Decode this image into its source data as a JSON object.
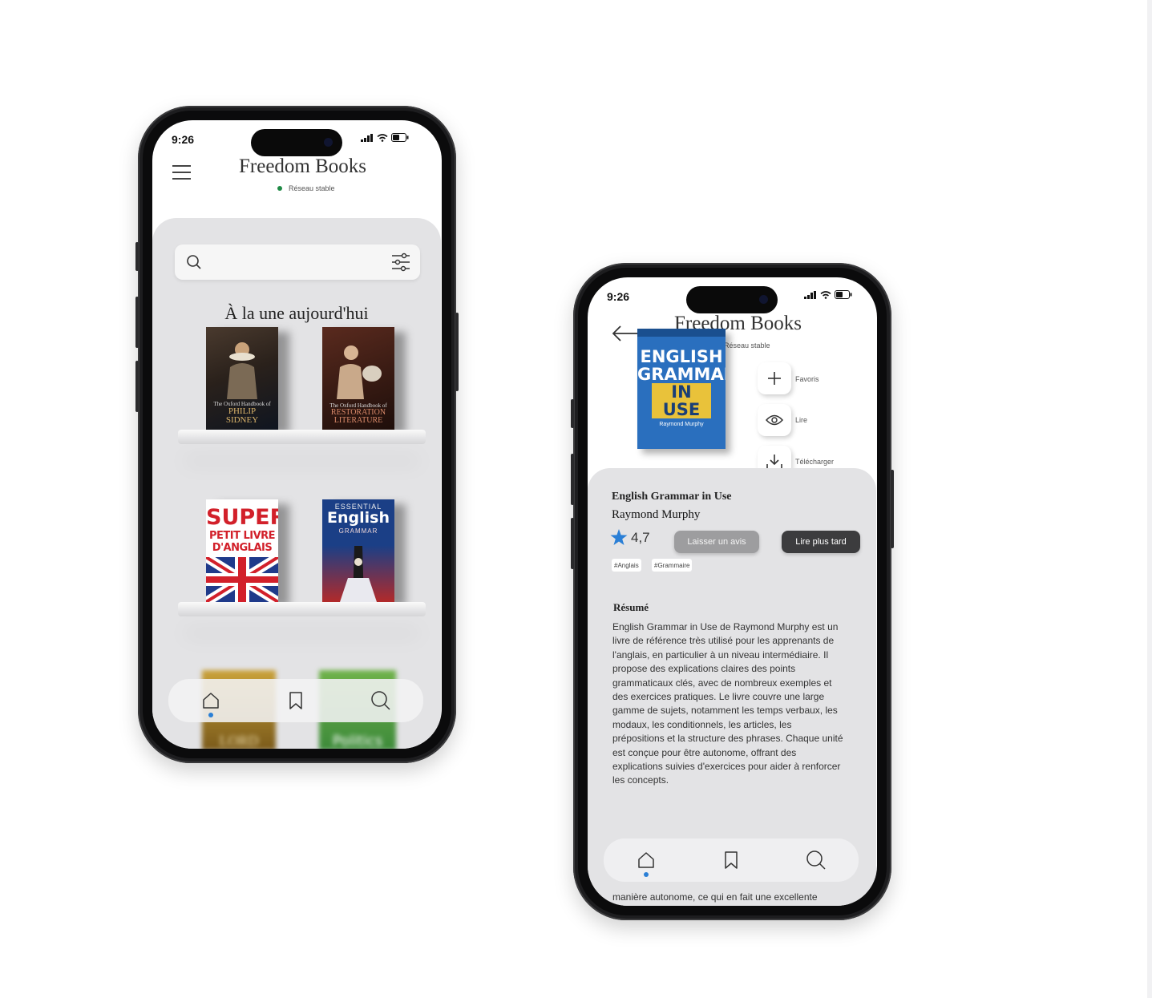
{
  "status": {
    "time": "9:26"
  },
  "app": {
    "title": "Freedom Books",
    "network": "Réseau stable"
  },
  "home": {
    "featured_title": "À la une aujourd'hui",
    "books": [
      {
        "line1": "The Oxford Handbook of",
        "line2": "PHILIP",
        "line3": "SIDNEY"
      },
      {
        "line1": "The Oxford Handbook of",
        "line2": "RESTORATION",
        "line3": "LITERATURE"
      },
      {
        "line1": "SUPER",
        "line2": "PETIT LIVRE",
        "line3": "D'ANGLAIS"
      },
      {
        "line1": "ESSENTIAL",
        "line2": "English",
        "line3": "GRAMMAR"
      }
    ],
    "partial_books": {
      "left": "LORD",
      "right": "Politics"
    }
  },
  "details": {
    "cover": {
      "line1": "ENGLISH",
      "line2": "GRAMMAR",
      "line3": "IN USE",
      "author": "Raymond Murphy"
    },
    "actions": {
      "favorites": "Favoris",
      "read": "Lire",
      "download": "Télécharger"
    },
    "title": "English Grammar in Use",
    "author": "Raymond Murphy",
    "rating": "4,7",
    "review_button": "Laisser un avis",
    "read_later_button": "Lire plus tard",
    "tags": [
      "#Anglais",
      "#Grammaire"
    ],
    "summary_title": "Résumé",
    "summary": "English Grammar in Use de Raymond Murphy est un livre de référence très utilisé pour les apprenants de l'anglais, en particulier à un niveau intermédiaire. Il propose des explications claires des points grammaticaux clés, avec de nombreux exemples et des exercices pratiques. Le livre couvre une large gamme de sujets, notamment les temps verbaux, les modaux, les conditionnels, les articles, les prépositions et la structure des phrases. Chaque unité est conçue pour être autonome, offrant des explications suivies d'exercices pour aider à renforcer les concepts.",
    "summary_tail": "manière autonome, ce qui en fait une excellente ressource pour l'auto-apprentissage ou"
  },
  "colors": {
    "accent": "#2a7fd6",
    "network_dot": "#1f8a45",
    "panel": "#e3e3e5",
    "dark_button": "#3c3c3e",
    "light_button": "#9d9d9f"
  }
}
